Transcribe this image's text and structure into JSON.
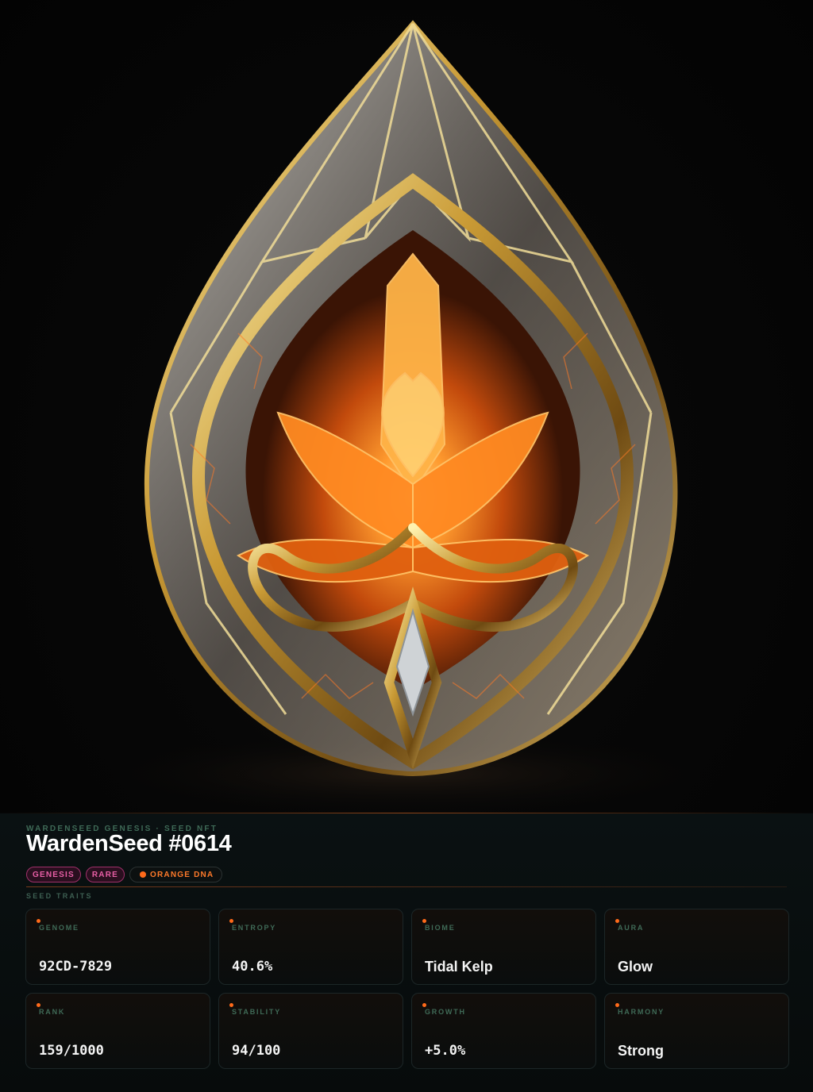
{
  "nft": {
    "collection": "WARDENSEED GENESIS · SEED NFT",
    "title": "WardenSeed #0614",
    "tags": [
      {
        "label": "GENESIS",
        "style": "pink"
      },
      {
        "label": "RARE",
        "style": "pink"
      },
      {
        "label": "ORANGE DNA",
        "style": "dna"
      }
    ]
  },
  "traits_section": {
    "label": "SEED TRAITS",
    "items": [
      {
        "label": "GENOME",
        "value": "92CD-7829"
      },
      {
        "label": "ENTROPY",
        "value": "40.6%"
      },
      {
        "label": "BIOME",
        "value": "Tidal Kelp"
      },
      {
        "label": "AURA",
        "value": "Glow"
      },
      {
        "label": "RANK",
        "value": "159/1000"
      },
      {
        "label": "STABILITY",
        "value": "94/100"
      },
      {
        "label": "GROWTH",
        "value": "+5.0%"
      },
      {
        "label": "HARMONY",
        "value": "Strong"
      }
    ]
  },
  "colors": {
    "accent": "#ff6a1a",
    "tag_pink": "#e85fa6",
    "label_green": "#3f6a57",
    "panel_bg": "#0a1112"
  },
  "image": {
    "icon": "crystal-seed-artwork"
  }
}
